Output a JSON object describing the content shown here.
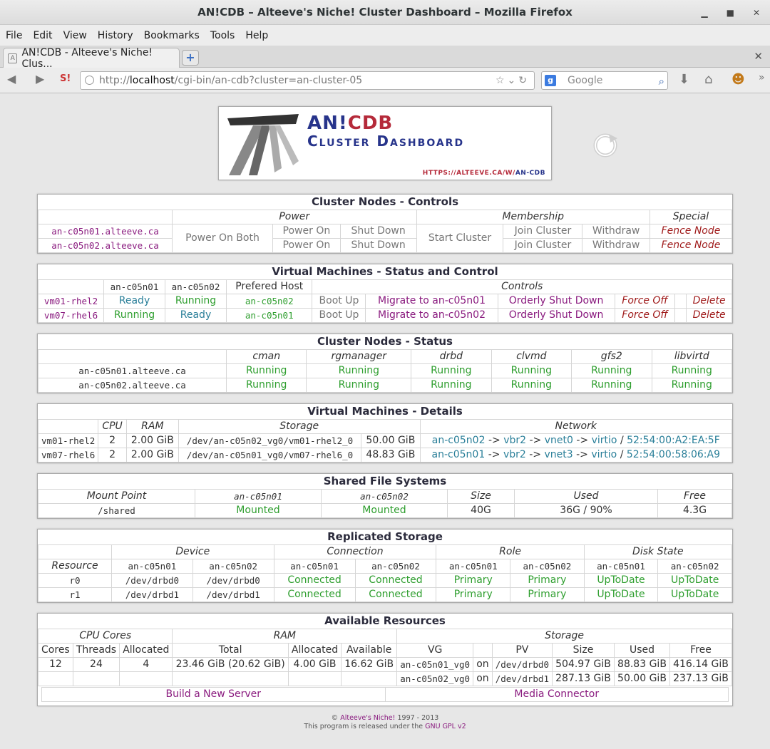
{
  "window": {
    "title": "AN!CDB – Alteeve's Niche! Cluster Dashboard – Mozilla Firefox"
  },
  "menu": [
    "File",
    "Edit",
    "View",
    "History",
    "Bookmarks",
    "Tools",
    "Help"
  ],
  "tab": {
    "title": "AN!CDB - Alteeve's Niche! Clus..."
  },
  "url": {
    "prefix": "http://",
    "host": "localhost",
    "path": "/cgi-bin/an-cdb?cluster=an-cluster-05"
  },
  "search": {
    "placeholder": "Google"
  },
  "logo": {
    "line1a": "AN!",
    "line1b": "CDB",
    "line2": "Cluster Dashboard",
    "url_a": "HTTPS://ALTEEVE.CA/W/",
    "url_b": "AN-CDB"
  },
  "nodes_controls": {
    "title": "Cluster Nodes - Controls",
    "headers": {
      "power": "Power",
      "membership": "Membership",
      "special": "Special"
    },
    "power_on_both": "Power On Both",
    "start_cluster": "Start Cluster",
    "rows": [
      {
        "node": "an-c05n01.alteeve.ca",
        "power_on": "Power On",
        "shut_down": "Shut Down",
        "join": "Join Cluster",
        "withdraw": "Withdraw",
        "fence": "Fence Node"
      },
      {
        "node": "an-c05n02.alteeve.ca",
        "power_on": "Power On",
        "shut_down": "Shut Down",
        "join": "Join Cluster",
        "withdraw": "Withdraw",
        "fence": "Fence Node"
      }
    ]
  },
  "vm_status": {
    "title": "Virtual Machines - Status and Control",
    "headers": {
      "n1": "an-c05n01",
      "n2": "an-c05n02",
      "pref": "Prefered Host",
      "controls": "Controls"
    },
    "rows": [
      {
        "vm": "vm01-rhel2",
        "n1": "Ready",
        "n2": "Running",
        "pref": "an-c05n02",
        "boot": "Boot Up",
        "migrate": "Migrate to an-c05n01",
        "shutdown": "Orderly Shut Down",
        "force": "Force Off",
        "delete": "Delete"
      },
      {
        "vm": "vm07-rhel6",
        "n1": "Running",
        "n2": "Ready",
        "pref": "an-c05n01",
        "boot": "Boot Up",
        "migrate": "Migrate to an-c05n02",
        "shutdown": "Orderly Shut Down",
        "force": "Force Off",
        "delete": "Delete"
      }
    ]
  },
  "nodes_status": {
    "title": "Cluster Nodes - Status",
    "headers": [
      "cman",
      "rgmanager",
      "drbd",
      "clvmd",
      "gfs2",
      "libvirtd"
    ],
    "rows": [
      {
        "node": "an-c05n01.alteeve.ca",
        "vals": [
          "Running",
          "Running",
          "Running",
          "Running",
          "Running",
          "Running"
        ]
      },
      {
        "node": "an-c05n02.alteeve.ca",
        "vals": [
          "Running",
          "Running",
          "Running",
          "Running",
          "Running",
          "Running"
        ]
      }
    ]
  },
  "vm_details": {
    "title": "Virtual Machines - Details",
    "headers": {
      "cpu": "CPU",
      "ram": "RAM",
      "storage": "Storage",
      "network": "Network"
    },
    "rows": [
      {
        "vm": "vm01-rhel2",
        "cpu": "2",
        "ram": "2.00 GiB",
        "lv": "/dev/an-c05n02_vg0/vm01-rhel2_0",
        "size": "50.00 GiB",
        "host": "an-c05n02",
        "bridge": "vbr2",
        "vnet": "vnet0",
        "model": "virtio",
        "mac": "52:54:00:A2:EA:5F"
      },
      {
        "vm": "vm07-rhel6",
        "cpu": "2",
        "ram": "2.00 GiB",
        "lv": "/dev/an-c05n01_vg0/vm07-rhel6_0",
        "size": "48.83 GiB",
        "host": "an-c05n01",
        "bridge": "vbr2",
        "vnet": "vnet3",
        "model": "virtio",
        "mac": "52:54:00:58:06:A9"
      }
    ],
    "arrow": "->",
    "slash": "/"
  },
  "shared_fs": {
    "title": "Shared File Systems",
    "headers": {
      "mount": "Mount Point",
      "n1": "an-c05n01",
      "n2": "an-c05n02",
      "size": "Size",
      "used": "Used",
      "free": "Free"
    },
    "row": {
      "mount": "/shared",
      "n1": "Mounted",
      "n2": "Mounted",
      "size": "40G",
      "used": "36G / 90%",
      "free": "4.3G"
    }
  },
  "replicated": {
    "title": "Replicated Storage",
    "headers": {
      "device": "Device",
      "connection": "Connection",
      "role": "Role",
      "disk": "Disk State",
      "resource": "Resource",
      "n1": "an-c05n01",
      "n2": "an-c05n02"
    },
    "rows": [
      {
        "res": "r0",
        "d1": "/dev/drbd0",
        "d2": "/dev/drbd0",
        "c1": "Connected",
        "c2": "Connected",
        "r1": "Primary",
        "r2": "Primary",
        "s1": "UpToDate",
        "s2": "UpToDate"
      },
      {
        "res": "r1",
        "d1": "/dev/drbd1",
        "d2": "/dev/drbd1",
        "c1": "Connected",
        "c2": "Connected",
        "r1": "Primary",
        "r2": "Primary",
        "s1": "UpToDate",
        "s2": "UpToDate"
      }
    ]
  },
  "resources": {
    "title": "Available Resources",
    "headers": {
      "cpu": "CPU Cores",
      "ram": "RAM",
      "storage": "Storage",
      "cores": "Cores",
      "threads": "Threads",
      "allocated": "Allocated",
      "total": "Total",
      "ram_alloc": "Allocated",
      "available": "Available",
      "vg": "VG",
      "pv": "PV",
      "size": "Size",
      "used": "Used",
      "free": "Free"
    },
    "cores": "12",
    "threads": "24",
    "allocated": "4",
    "ram_total": "23.46 GiB (20.62 GiB)",
    "ram_alloc": "4.00 GiB",
    "ram_avail": "16.62 GiB",
    "vgs": [
      {
        "vg": "an-c05n01_vg0",
        "on": "on",
        "pv": "/dev/drbd0",
        "size": "504.97 GiB",
        "used": "88.83 GiB",
        "free": "416.14 GiB"
      },
      {
        "vg": "an-c05n02_vg0",
        "on": "on",
        "pv": "/dev/drbd1",
        "size": "287.13 GiB",
        "used": "50.00 GiB",
        "free": "237.13 GiB"
      }
    ],
    "build": "Build a New Server",
    "media": "Media Connector"
  },
  "footer": {
    "copy": "©",
    "company": "Alteeve's Niche!",
    "years": "1997 - 2013",
    "line2": "This program is released under the",
    "license": "GNU GPL v2"
  }
}
